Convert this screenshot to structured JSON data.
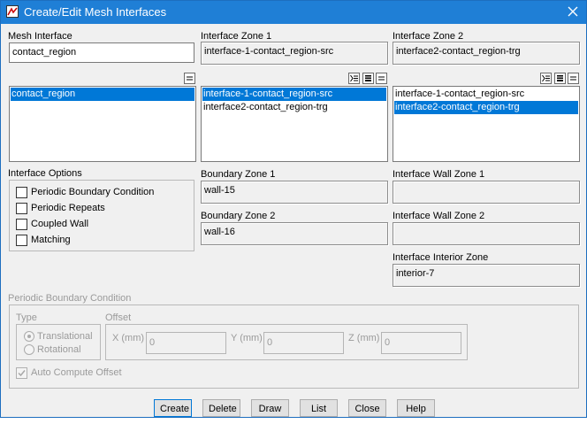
{
  "window": {
    "title": "Create/Edit Mesh Interfaces"
  },
  "mesh_interface": {
    "label": "Mesh Interface",
    "value": "contact_region",
    "items": [
      "contact_region"
    ]
  },
  "interface_zone_1": {
    "label": "Interface Zone 1",
    "value": "interface-1-contact_region-src",
    "items": [
      "interface-1-contact_region-src",
      "interface2-contact_region-trg"
    ],
    "selected": 0
  },
  "interface_zone_2": {
    "label": "Interface Zone 2",
    "value": "interface2-contact_region-trg",
    "items": [
      "interface-1-contact_region-src",
      "interface2-contact_region-trg"
    ],
    "selected": 1
  },
  "interface_options": {
    "label": "Interface Options",
    "items": [
      "Periodic Boundary Condition",
      "Periodic Repeats",
      "Coupled Wall",
      "Matching"
    ]
  },
  "boundary_zone_1": {
    "label": "Boundary Zone 1",
    "value": "wall-15"
  },
  "boundary_zone_2": {
    "label": "Boundary Zone 2",
    "value": "wall-16"
  },
  "interface_wall_zone_1": {
    "label": "Interface Wall Zone 1",
    "value": ""
  },
  "interface_wall_zone_2": {
    "label": "Interface Wall Zone 2",
    "value": ""
  },
  "interface_interior_zone": {
    "label": "Interface Interior Zone",
    "value": "interior-7"
  },
  "periodic": {
    "label": "Periodic Boundary Condition",
    "type_label": "Type",
    "type_options": [
      "Translational",
      "Rotational"
    ],
    "type_selected": "Translational",
    "offset_label": "Offset",
    "x_label": "X (mm)",
    "x_value": "0",
    "y_label": "Y (mm)",
    "y_value": "0",
    "z_label": "Z (mm)",
    "z_value": "0",
    "auto_compute": "Auto Compute Offset"
  },
  "buttons": {
    "create": "Create",
    "delete": "Delete",
    "draw": "Draw",
    "list": "List",
    "close": "Close",
    "help": "Help"
  },
  "colors": {
    "titlebar": "#1f7fd6",
    "selection": "#0078d7"
  }
}
